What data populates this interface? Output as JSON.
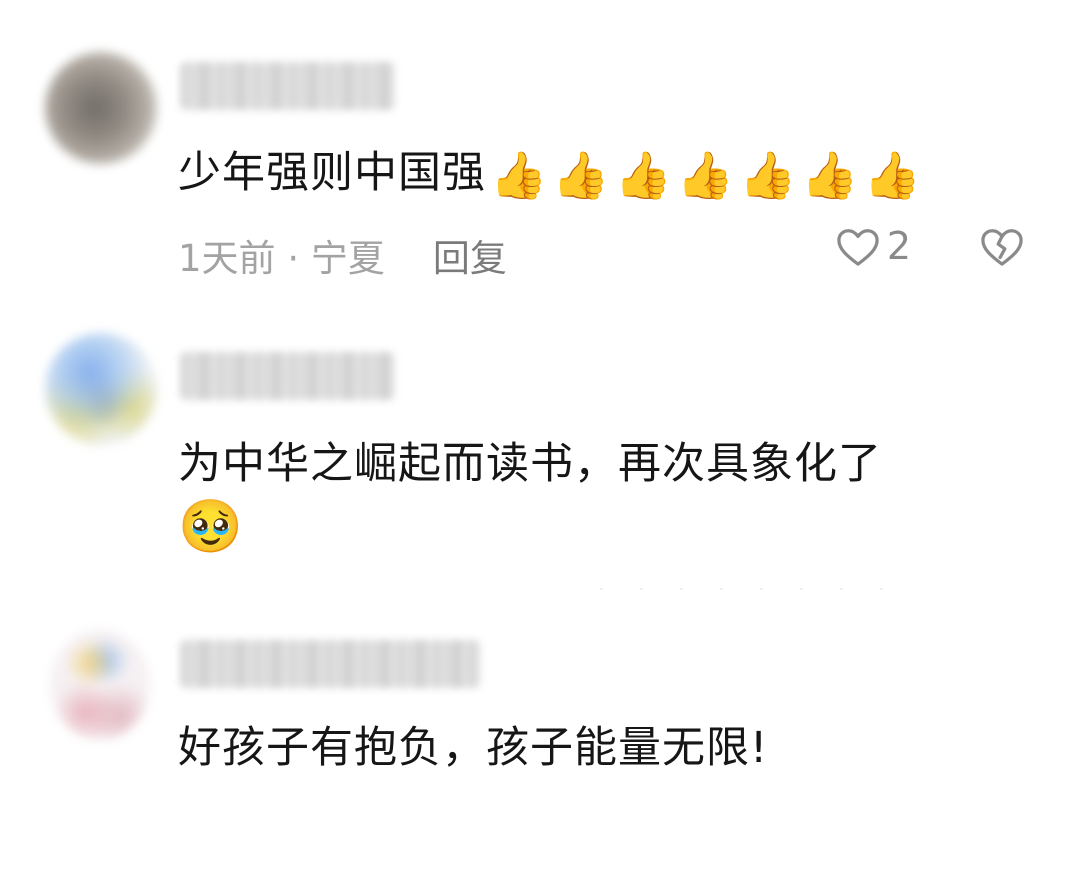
{
  "comments": [
    {
      "text": "少年强则中国强",
      "emoji": [
        "👍",
        "👍",
        "👍",
        "👍",
        "👍",
        "👍",
        "👍"
      ],
      "meta": {
        "time": "1天前",
        "separator": "·",
        "location": "宁夏",
        "reply_label": "回复",
        "like_count": "2"
      },
      "icons": {
        "like": "heart-outline-icon",
        "dislike": "broken-heart-icon"
      }
    },
    {
      "text": "为中华之崛起而读书，再次具象化了",
      "emoji": [
        "🥹"
      ]
    },
    {
      "text": "好孩子有抱负，孩子能量无限!"
    }
  ],
  "colors": {
    "text_primary": "#161616",
    "meta_text": "#a3a3a3",
    "reply_text": "#7b7b7b",
    "icon_gray": "#8a8a8a",
    "background": "#ffffff"
  }
}
